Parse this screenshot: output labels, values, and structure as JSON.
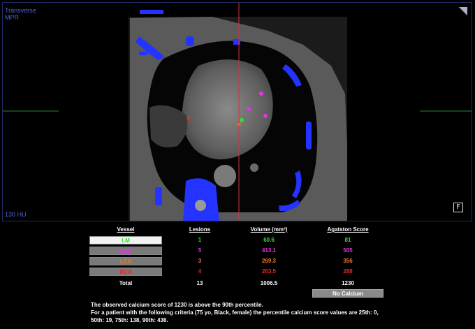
{
  "viewport": {
    "title_line1": "Transverse",
    "title_line2": "MPR",
    "hu_label": "130 HU",
    "f_button": "F",
    "colors": {
      "crosshair_v": "#d8323c",
      "crosshair_h": "#1f8a3a",
      "calcium": "#1f3cff",
      "label": "#4a66d8"
    }
  },
  "table": {
    "headers": {
      "vessel": "Vessel",
      "lesions": "Lesions",
      "volume": "Volume (mm³)",
      "agatston": "Agatston Score"
    },
    "rows": [
      {
        "vessel": "LM",
        "lesions": "1",
        "volume": "60.6",
        "agatston": "81",
        "color": "#33e033",
        "btn_bg": "#f2f2f2"
      },
      {
        "vessel": "LAD",
        "lesions": "5",
        "volume": "413.1",
        "agatston": "505",
        "color": "#e633e6",
        "btn_bg": "#7a7a7a"
      },
      {
        "vessel": "LCX",
        "lesions": "3",
        "volume": "269.3",
        "agatston": "356",
        "color": "#f07a2a",
        "btn_bg": "#7a7a7a"
      },
      {
        "vessel": "RCA",
        "lesions": "4",
        "volume": "263.5",
        "agatston": "288",
        "color": "#e62a2a",
        "btn_bg": "#7a7a7a"
      }
    ],
    "total": {
      "label": "Total",
      "lesions": "13",
      "volume": "1006.5",
      "agatston": "1230"
    },
    "no_calcium_button": "No Calcium"
  },
  "message": {
    "line1": "The observed calcium score of 1230 is above the 90th percentile.",
    "line2": "For a patient with the following criteria (75 yo, Black, female) the percentile calcium score values are 25th: 0,",
    "line3": "50th: 19, 75th: 138, 90th: 436."
  }
}
